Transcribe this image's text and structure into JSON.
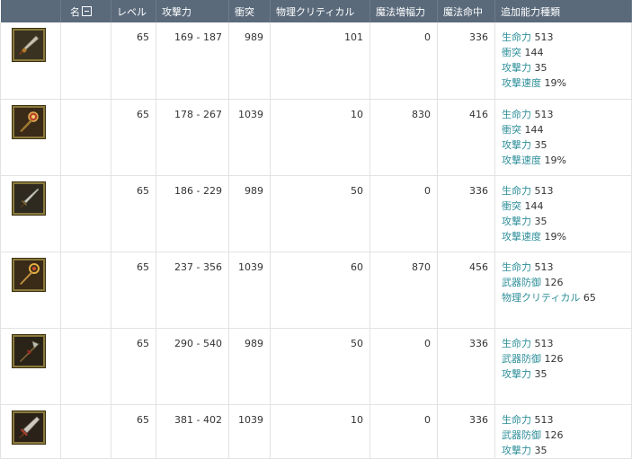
{
  "columns": {
    "icon": "",
    "name": "名",
    "level": "レベル",
    "attack": "攻撃力",
    "impact": "衝突",
    "physical_critical": "物理クリティカル",
    "magic_amp": "魔法増幅力",
    "magic_hit": "魔法命中",
    "bonus": "追加能力種類"
  },
  "rows": [
    {
      "icon": "dagger-icon",
      "name": "",
      "level": "65",
      "attack": "169 - 187",
      "impact": "989",
      "physical_critical": "101",
      "magic_amp": "0",
      "magic_hit": "336",
      "bonus": [
        {
          "label": "生命力",
          "value": "513"
        },
        {
          "label": "衝突",
          "value": "144"
        },
        {
          "label": "攻撃力",
          "value": "35"
        },
        {
          "label": "攻撃速度",
          "value": "19%"
        }
      ]
    },
    {
      "icon": "mace-icon",
      "name": "",
      "level": "65",
      "attack": "178 - 267",
      "impact": "1039",
      "physical_critical": "10",
      "magic_amp": "830",
      "magic_hit": "416",
      "bonus": [
        {
          "label": "生命力",
          "value": "513"
        },
        {
          "label": "衝突",
          "value": "144"
        },
        {
          "label": "攻撃力",
          "value": "35"
        },
        {
          "label": "攻撃速度",
          "value": "19%"
        }
      ]
    },
    {
      "icon": "sword-icon",
      "name": "",
      "level": "65",
      "attack": "186 - 229",
      "impact": "989",
      "physical_critical": "50",
      "magic_amp": "0",
      "magic_hit": "336",
      "bonus": [
        {
          "label": "生命力",
          "value": "513"
        },
        {
          "label": "衝突",
          "value": "144"
        },
        {
          "label": "攻撃力",
          "value": "35"
        },
        {
          "label": "攻撃速度",
          "value": "19%"
        }
      ]
    },
    {
      "icon": "staff-icon",
      "name": "",
      "level": "65",
      "attack": "237 - 356",
      "impact": "1039",
      "physical_critical": "60",
      "magic_amp": "870",
      "magic_hit": "456",
      "bonus": [
        {
          "label": "生命力",
          "value": "513"
        },
        {
          "label": "武器防御",
          "value": "126"
        },
        {
          "label": "物理クリティカル",
          "value": "65"
        }
      ]
    },
    {
      "icon": "polearm-icon",
      "name": "",
      "level": "65",
      "attack": "290 - 540",
      "impact": "989",
      "physical_critical": "50",
      "magic_amp": "0",
      "magic_hit": "336",
      "bonus": [
        {
          "label": "生命力",
          "value": "513"
        },
        {
          "label": "武器防御",
          "value": "126"
        },
        {
          "label": "攻撃力",
          "value": "35"
        }
      ]
    },
    {
      "icon": "greatsword-icon",
      "name": "",
      "level": "65",
      "attack": "381 - 402",
      "impact": "1039",
      "physical_critical": "10",
      "magic_amp": "0",
      "magic_hit": "336",
      "bonus": [
        {
          "label": "生命力",
          "value": "513"
        },
        {
          "label": "武器防御",
          "value": "126"
        },
        {
          "label": "攻撃力",
          "value": "35"
        }
      ]
    }
  ],
  "colors": {
    "header_bg": "#5a6a7b",
    "stat_label": "#2e8f9a",
    "grid": "#e2e2e2"
  }
}
